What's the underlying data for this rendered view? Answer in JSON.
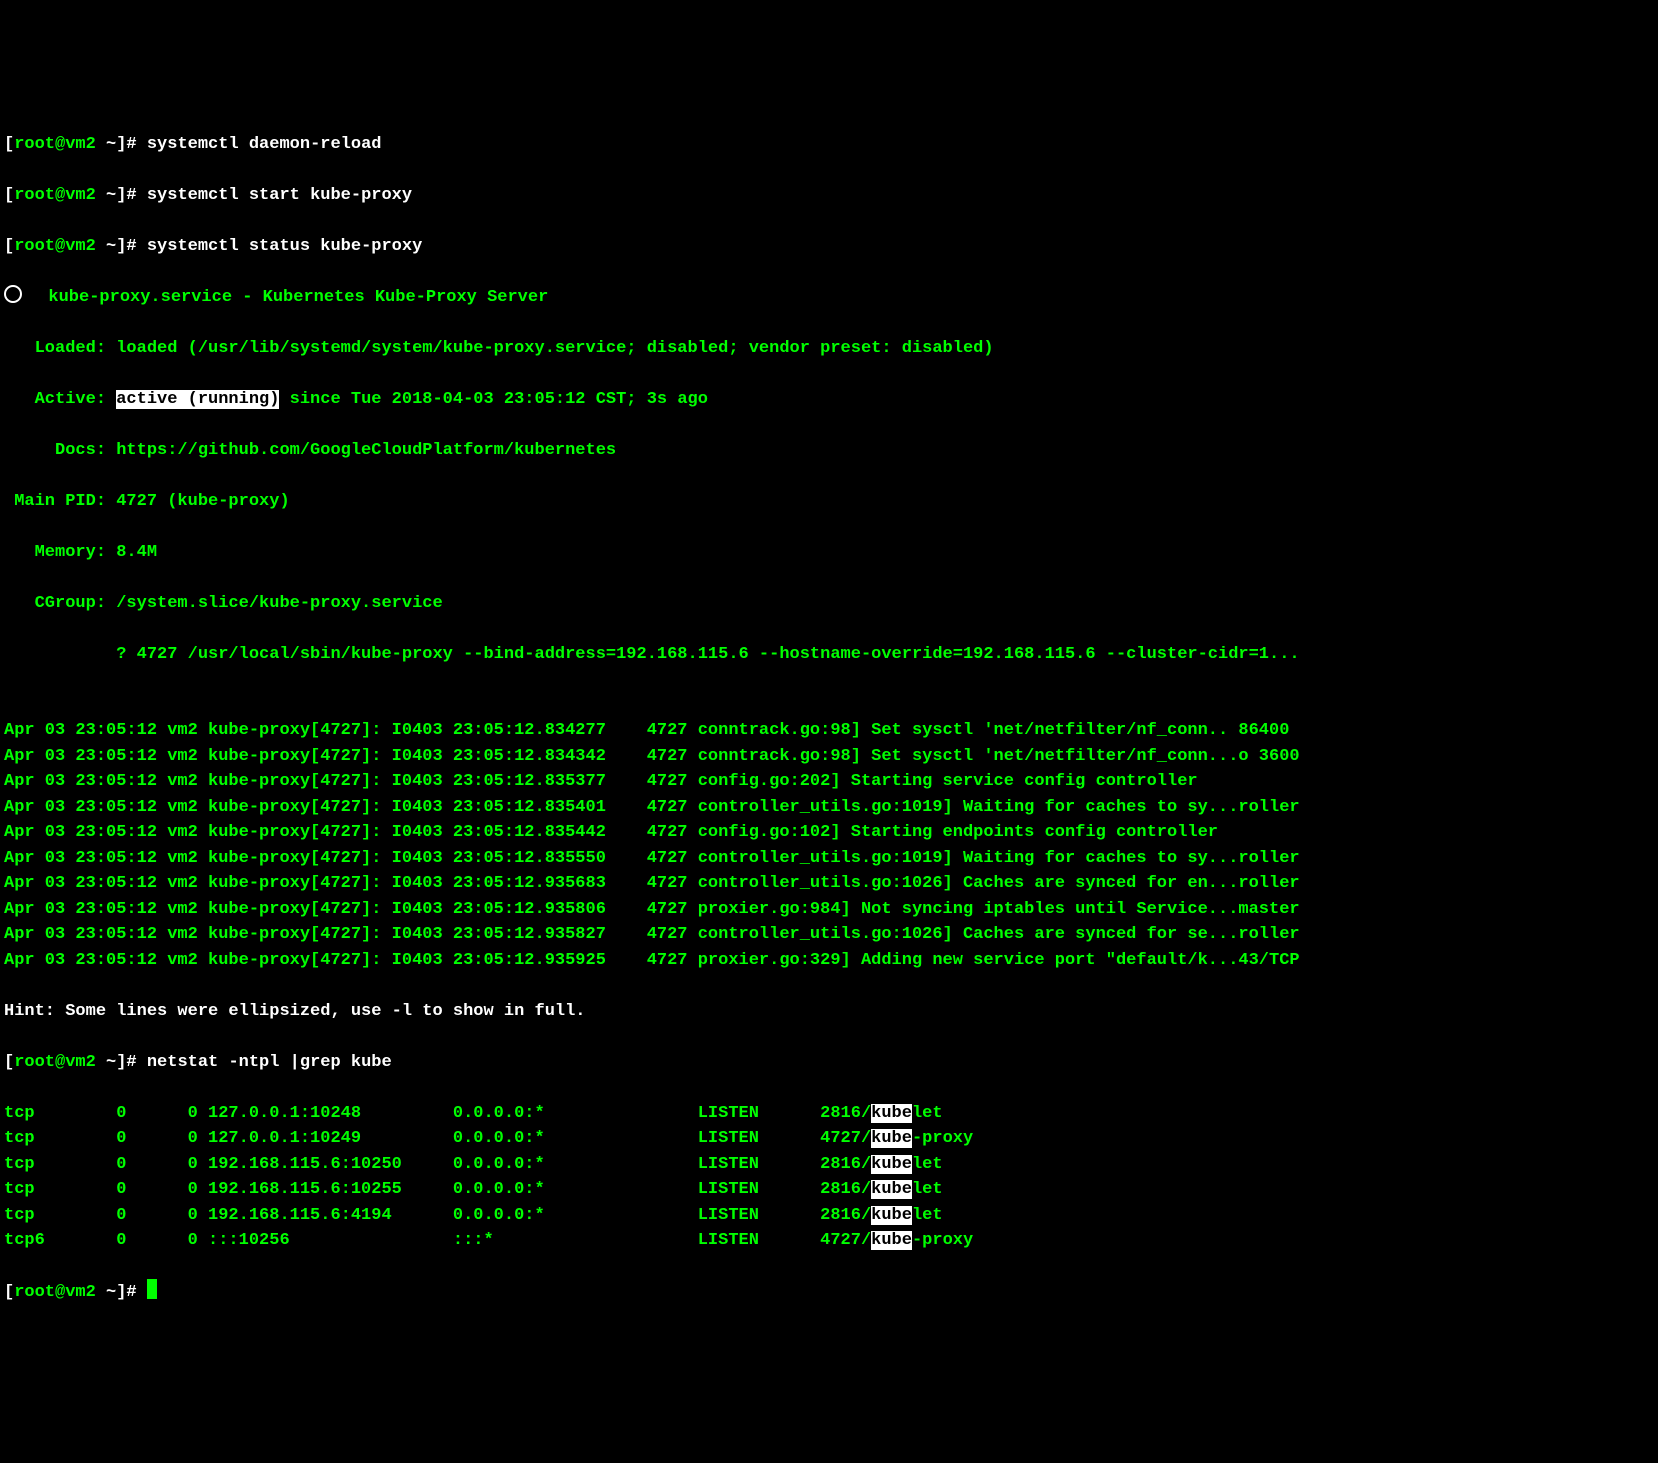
{
  "prompt1": {
    "bracket_open": "[",
    "user": "root@vm2 ",
    "tilde": "~",
    "bracket_close": "]# ",
    "cmd": "systemctl daemon-reload"
  },
  "prompt2": {
    "bracket_open": "[",
    "user": "root@vm2 ",
    "tilde": "~",
    "bracket_close": "]# ",
    "cmd": "systemctl start kube-proxy"
  },
  "prompt3": {
    "bracket_open": "[",
    "user": "root@vm2 ",
    "tilde": "~",
    "bracket_close": "]# ",
    "cmd": "systemctl status kube-proxy"
  },
  "service_line": "  kube-proxy.service - Kubernetes Kube-Proxy Server",
  "loaded_label": "   Loaded: ",
  "loaded_value": "loaded (/usr/lib/systemd/system/kube-proxy.service; disabled; vendor preset: disabled)",
  "active_label": "   Active: ",
  "active_value": "active (running)",
  "active_rest": " since Tue 2018-04-03 23:05:12 CST; 3s ago",
  "docs_label": "     Docs: ",
  "docs_value": "https://github.com/GoogleCloudPlatform/kubernetes",
  "pid_label": " Main PID: ",
  "pid_value": "4727 (kube-proxy)",
  "mem_label": "   Memory: ",
  "mem_value": "8.4M",
  "cgroup_label": "   CGroup: ",
  "cgroup_value": "/system.slice/kube-proxy.service",
  "cgroup_child": "           ? 4727 /usr/local/sbin/kube-proxy --bind-address=192.168.115.6 --hostname-override=192.168.115.6 --cluster-cidr=1...",
  "blank": "",
  "logs": [
    "Apr 03 23:05:12 vm2 kube-proxy[4727]: I0403 23:05:12.834277    4727 conntrack.go:98] Set sysctl 'net/netfilter/nf_conn.. 86400",
    "Apr 03 23:05:12 vm2 kube-proxy[4727]: I0403 23:05:12.834342    4727 conntrack.go:98] Set sysctl 'net/netfilter/nf_conn...o 3600",
    "Apr 03 23:05:12 vm2 kube-proxy[4727]: I0403 23:05:12.835377    4727 config.go:202] Starting service config controller",
    "Apr 03 23:05:12 vm2 kube-proxy[4727]: I0403 23:05:12.835401    4727 controller_utils.go:1019] Waiting for caches to sy...roller",
    "Apr 03 23:05:12 vm2 kube-proxy[4727]: I0403 23:05:12.835442    4727 config.go:102] Starting endpoints config controller",
    "Apr 03 23:05:12 vm2 kube-proxy[4727]: I0403 23:05:12.835550    4727 controller_utils.go:1019] Waiting for caches to sy...roller",
    "Apr 03 23:05:12 vm2 kube-proxy[4727]: I0403 23:05:12.935683    4727 controller_utils.go:1026] Caches are synced for en...roller",
    "Apr 03 23:05:12 vm2 kube-proxy[4727]: I0403 23:05:12.935806    4727 proxier.go:984] Not syncing iptables until Service...master",
    "Apr 03 23:05:12 vm2 kube-proxy[4727]: I0403 23:05:12.935827    4727 controller_utils.go:1026] Caches are synced for se...roller",
    "Apr 03 23:05:12 vm2 kube-proxy[4727]: I0403 23:05:12.935925    4727 proxier.go:329] Adding new service port \"default/k...43/TCP"
  ],
  "hint": "Hint: Some lines were ellipsized, use -l to show in full.",
  "prompt4": {
    "bracket_open": "[",
    "user": "root@vm2 ",
    "tilde": "~",
    "bracket_close": "]# ",
    "cmd": "netstat -ntpl |grep kube"
  },
  "net": [
    {
      "pre": "tcp        0      0 127.0.0.1:10248         0.0.0.0:*               LISTEN      2816/",
      "hl": "kube",
      "post": "let"
    },
    {
      "pre": "tcp        0      0 127.0.0.1:10249         0.0.0.0:*               LISTEN      4727/",
      "hl": "kube",
      "post": "-proxy"
    },
    {
      "pre": "tcp        0      0 192.168.115.6:10250     0.0.0.0:*               LISTEN      2816/",
      "hl": "kube",
      "post": "let"
    },
    {
      "pre": "tcp        0      0 192.168.115.6:10255     0.0.0.0:*               LISTEN      2816/",
      "hl": "kube",
      "post": "let"
    },
    {
      "pre": "tcp        0      0 192.168.115.6:4194      0.0.0.0:*               LISTEN      2816/",
      "hl": "kube",
      "post": "let"
    },
    {
      "pre": "tcp6       0      0 :::10256                :::*                    LISTEN      4727/",
      "hl": "kube",
      "post": "-proxy"
    }
  ],
  "prompt5": {
    "bracket_open": "[",
    "user": "root@vm2 ",
    "tilde": "~",
    "bracket_close": "]# "
  }
}
